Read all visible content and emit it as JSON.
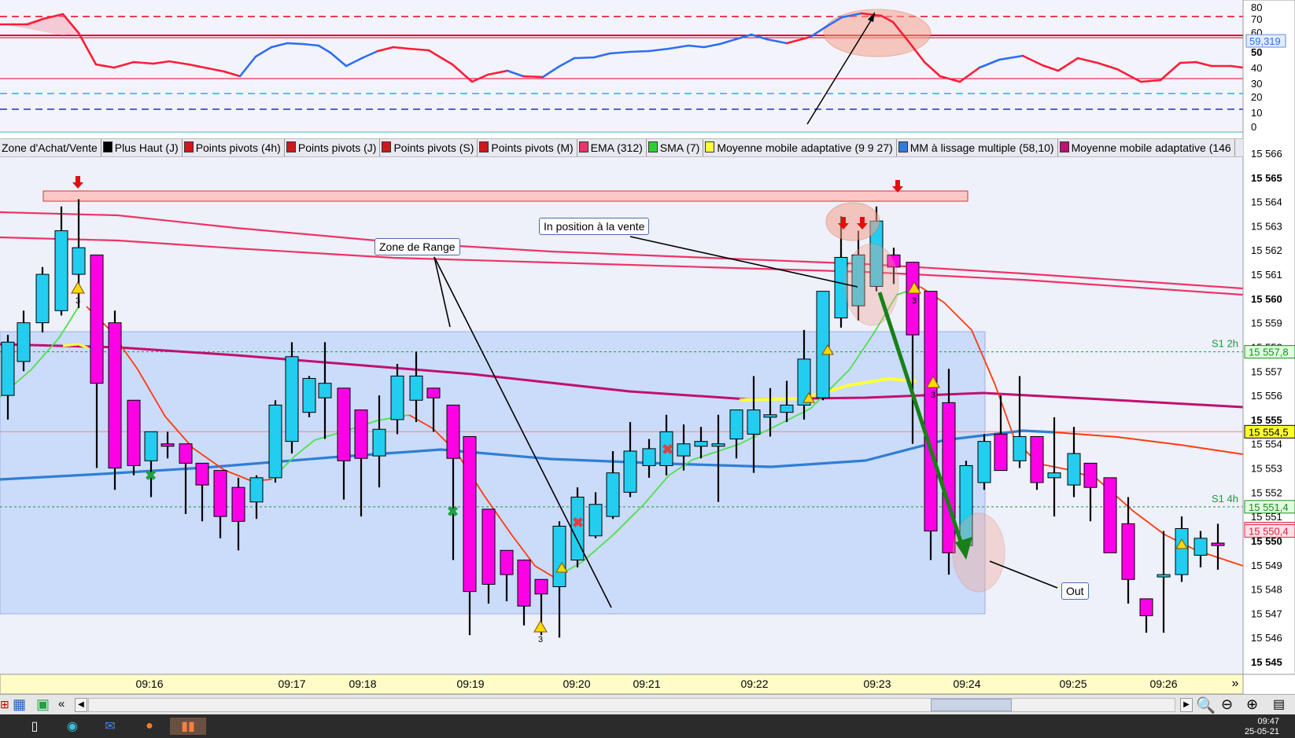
{
  "colors": {
    "bull": "#22cdf0",
    "bear": "#ff00e6",
    "range_zone": "#c6d8fa",
    "resistance": "#ff5560",
    "ema312": "#ef3366",
    "adaptive": "#c01070",
    "sma7": "#2e7fd4",
    "fast_red": "#ff3a10",
    "fast_green": "#50e050",
    "yellow": "#ffff40",
    "rsi_red": "#ff1c38",
    "rsi_blue": "#2d6ef5",
    "axis_bg": "#fffcc8"
  },
  "legend": [
    {
      "label": "Zone d'Achat/Vente",
      "swatch": "#999999"
    },
    {
      "label": "Plus Haut (J)",
      "swatch": "#000000"
    },
    {
      "label": "Points pivots (4h)",
      "swatch": "#d01818"
    },
    {
      "label": "Points pivots (J)",
      "swatch": "#d01818"
    },
    {
      "label": "Points pivots (S)",
      "swatch": "#d01818"
    },
    {
      "label": "Points pivots (M)",
      "swatch": "#d01818"
    },
    {
      "label": "EMA (312)",
      "swatch": "#ef3366"
    },
    {
      "label": "SMA (7)",
      "swatch": "#30d030"
    },
    {
      "label": "Moyenne mobile adaptative (9 9 27)",
      "swatch": "#ffff40"
    },
    {
      "label": "MM à lissage multiple (58,10)",
      "swatch": "#2e7fd4"
    },
    {
      "label": "Moyenne mobile adaptative (146",
      "swatch": "#c01070"
    }
  ],
  "rsi_axis": [
    "80",
    "70",
    "60",
    "50",
    "40",
    "30",
    "20",
    "10",
    "0"
  ],
  "rsi_current": "59,319",
  "price_axis": [
    "15 566",
    "15 565",
    "15 564",
    "15 563",
    "15 562",
    "15 561",
    "15 560",
    "15 559",
    "15 558",
    "15 557",
    "15 556",
    "15 555",
    "15 554",
    "15 553",
    "15 552",
    "15 551",
    "15 550",
    "15 549",
    "15 548",
    "15 547",
    "15 546",
    "15 545"
  ],
  "price_tags": [
    {
      "text": "15 557,8",
      "price": 15557.8,
      "bg": "#dfffe0",
      "fg": "#1a8a1a"
    },
    {
      "text": "15 554,5",
      "price": 15554.5,
      "bg": "#ffff30",
      "fg": "#000000"
    },
    {
      "text": "15 551,4",
      "price": 15551.4,
      "bg": "#dfffe0",
      "fg": "#1a8a1a"
    },
    {
      "text": "15 550,5",
      "price": 15550.5,
      "bg": "#ffe0e8",
      "fg": "#e02040"
    },
    {
      "text": "15 550,4",
      "price": 15550.4,
      "bg": "#ffe0e8",
      "fg": "#e02040"
    }
  ],
  "pivot_labels": [
    {
      "text": "S1 2h",
      "price": 15557.8
    },
    {
      "text": "S1 4h",
      "price": 15551.4
    }
  ],
  "time_axis": [
    "09:16",
    "09:17",
    "09:18",
    "09:19",
    "09:20",
    "09:21",
    "09:22",
    "09:23",
    "09:24",
    "09:25",
    "09:26"
  ],
  "callouts": {
    "range": "Zone de Range",
    "short": "In position à la vente",
    "out": "Out"
  },
  "alert_counts": [
    "3",
    "3",
    "3",
    "3"
  ],
  "clock": {
    "time": "09:47",
    "date": "25-05-21"
  },
  "chart_data": {
    "type": "candlestick",
    "ylim": [
      15544.5,
      15566.3
    ],
    "candles": [
      {
        "o": 15556,
        "h": 15558.5,
        "l": 15555,
        "c": 15558.2
      },
      {
        "o": 15557.4,
        "h": 15559.5,
        "l": 15557,
        "c": 15559
      },
      {
        "o": 15559,
        "h": 15561.3,
        "l": 15558.6,
        "c": 15561
      },
      {
        "o": 15559.5,
        "h": 15563.8,
        "l": 15559.3,
        "c": 15562.8
      },
      {
        "o": 15561,
        "h": 15564.1,
        "l": 15559.6,
        "c": 15562.1
      },
      {
        "o": 15561.8,
        "h": 15561.8,
        "l": 15553,
        "c": 15556.5
      },
      {
        "o": 15559,
        "h": 15559.5,
        "l": 15552.1,
        "c": 15553
      },
      {
        "o": 15555.8,
        "h": 15555.8,
        "l": 15552.7,
        "c": 15553.1
      },
      {
        "o": 15553.3,
        "h": 15554.5,
        "l": 15551.8,
        "c": 15554.5
      },
      {
        "o": 15554,
        "h": 15554.5,
        "l": 15553.4,
        "c": 15553.9
      },
      {
        "o": 15554,
        "h": 15554,
        "l": 15551.1,
        "c": 15553.2
      },
      {
        "o": 15553.2,
        "h": 15553.2,
        "l": 15550.8,
        "c": 15552.3
      },
      {
        "o": 15552.9,
        "h": 15552.9,
        "l": 15550.1,
        "c": 15551
      },
      {
        "o": 15552.2,
        "h": 15552.6,
        "l": 15549.6,
        "c": 15550.8
      },
      {
        "o": 15551.6,
        "h": 15552.7,
        "l": 15550.9,
        "c": 15552.6
      },
      {
        "o": 15552.6,
        "h": 15555.8,
        "l": 15552.4,
        "c": 15555.6
      },
      {
        "o": 15554.1,
        "h": 15558.2,
        "l": 15553.6,
        "c": 15557.6
      },
      {
        "o": 15555.3,
        "h": 15556.8,
        "l": 15555.1,
        "c": 15556.7
      },
      {
        "o": 15555.9,
        "h": 15558.2,
        "l": 15554.2,
        "c": 15556.5
      },
      {
        "o": 15556.3,
        "h": 15556.3,
        "l": 15551.7,
        "c": 15553.3
      },
      {
        "o": 15555.4,
        "h": 15555.4,
        "l": 15551,
        "c": 15553.4
      },
      {
        "o": 15553.5,
        "h": 15556,
        "l": 15552.2,
        "c": 15554.6
      },
      {
        "o": 15555,
        "h": 15557.3,
        "l": 15554.4,
        "c": 15556.8
      },
      {
        "o": 15555.8,
        "h": 15557.8,
        "l": 15554.9,
        "c": 15556.8
      },
      {
        "o": 15556.3,
        "h": 15556.3,
        "l": 15554.5,
        "c": 15555.9
      },
      {
        "o": 15555.6,
        "h": 15555.6,
        "l": 15549.2,
        "c": 15553.4
      },
      {
        "o": 15554.3,
        "h": 15554.3,
        "l": 15546.1,
        "c": 15547.9
      },
      {
        "o": 15551.3,
        "h": 15551.3,
        "l": 15547.4,
        "c": 15548.2
      },
      {
        "o": 15549.6,
        "h": 15549.6,
        "l": 15547.5,
        "c": 15548.6
      },
      {
        "o": 15549.2,
        "h": 15549.2,
        "l": 15546.5,
        "c": 15547.3
      },
      {
        "o": 15548.4,
        "h": 15548.4,
        "l": 15546.1,
        "c": 15547.8
      },
      {
        "o": 15548.1,
        "h": 15550.8,
        "l": 15546,
        "c": 15550.6
      },
      {
        "o": 15549.2,
        "h": 15552.2,
        "l": 15548.9,
        "c": 15551.8
      },
      {
        "o": 15550.2,
        "h": 15552,
        "l": 15550.1,
        "c": 15551.5
      },
      {
        "o": 15551,
        "h": 15553.7,
        "l": 15550.9,
        "c": 15552.8
      },
      {
        "o": 15552,
        "h": 15554.9,
        "l": 15551.8,
        "c": 15553.7
      },
      {
        "o": 15553.1,
        "h": 15554.2,
        "l": 15552.6,
        "c": 15553.8
      },
      {
        "o": 15553.1,
        "h": 15555.2,
        "l": 15552.7,
        "c": 15554.5
      },
      {
        "o": 15553.5,
        "h": 15554.8,
        "l": 15552.9,
        "c": 15554
      },
      {
        "o": 15553.9,
        "h": 15554.7,
        "l": 15553.4,
        "c": 15554.1
      },
      {
        "o": 15553.9,
        "h": 15555.2,
        "l": 15551.6,
        "c": 15554
      },
      {
        "o": 15554.2,
        "h": 15555.3,
        "l": 15553.4,
        "c": 15555.4
      },
      {
        "o": 15554.4,
        "h": 15556.8,
        "l": 15552.8,
        "c": 15555.4
      },
      {
        "o": 15555.1,
        "h": 15556.3,
        "l": 15554.3,
        "c": 15555.2
      },
      {
        "o": 15555.3,
        "h": 15556.6,
        "l": 15554.9,
        "c": 15555.6
      },
      {
        "o": 15555.6,
        "h": 15558.7,
        "l": 15555,
        "c": 15557.5
      },
      {
        "o": 15555.9,
        "h": 15559.9,
        "l": 15555.8,
        "c": 15560.3
      },
      {
        "o": 15559.2,
        "h": 15563.4,
        "l": 15558.8,
        "c": 15561.7
      },
      {
        "o": 15559.7,
        "h": 15562.8,
        "l": 15559.1,
        "c": 15561.8
      },
      {
        "o": 15560.5,
        "h": 15563.8,
        "l": 15560.3,
        "c": 15563.2
      },
      {
        "o": 15561.8,
        "h": 15562.1,
        "l": 15560.6,
        "c": 15561.3
      },
      {
        "o": 15561.5,
        "h": 15561.5,
        "l": 15554,
        "c": 15558.5
      },
      {
        "o": 15560.3,
        "h": 15560.3,
        "l": 15549.2,
        "c": 15550.4
      },
      {
        "o": 15555.7,
        "h": 15557.1,
        "l": 15548.6,
        "c": 15549.5
      },
      {
        "o": 15549.8,
        "h": 15553.3,
        "l": 15549.3,
        "c": 15553.1
      },
      {
        "o": 15552.4,
        "h": 15554.4,
        "l": 15552.1,
        "c": 15554.1
      },
      {
        "o": 15554.4,
        "h": 15556,
        "l": 15552.9,
        "c": 15552.9
      },
      {
        "o": 15553.3,
        "h": 15556.8,
        "l": 15553,
        "c": 15554.3
      },
      {
        "o": 15554.3,
        "h": 15554.3,
        "l": 15552.1,
        "c": 15552.4
      },
      {
        "o": 15552.6,
        "h": 15555.1,
        "l": 15551,
        "c": 15552.8
      },
      {
        "o": 15552.3,
        "h": 15554.7,
        "l": 15551.8,
        "c": 15553.6
      },
      {
        "o": 15553.2,
        "h": 15553.2,
        "l": 15550.8,
        "c": 15552.2
      },
      {
        "o": 15552.6,
        "h": 15552.6,
        "l": 15549.9,
        "c": 15549.5
      },
      {
        "o": 15550.7,
        "h": 15551.8,
        "l": 15547.4,
        "c": 15548.4
      },
      {
        "o": 15547.6,
        "h": 15547.6,
        "l": 15546.2,
        "c": 15546.9
      },
      {
        "o": 15548.6,
        "h": 15550.4,
        "l": 15546.2,
        "c": 15548.6
      },
      {
        "o": 15548.6,
        "h": 15551,
        "l": 15548.3,
        "c": 15550.5
      },
      {
        "o": 15549.4,
        "h": 15550.4,
        "l": 15548.9,
        "c": 15550.1
      },
      {
        "o": 15549.9,
        "h": 15550.7,
        "l": 15548.8,
        "c": 15549.8
      }
    ]
  }
}
